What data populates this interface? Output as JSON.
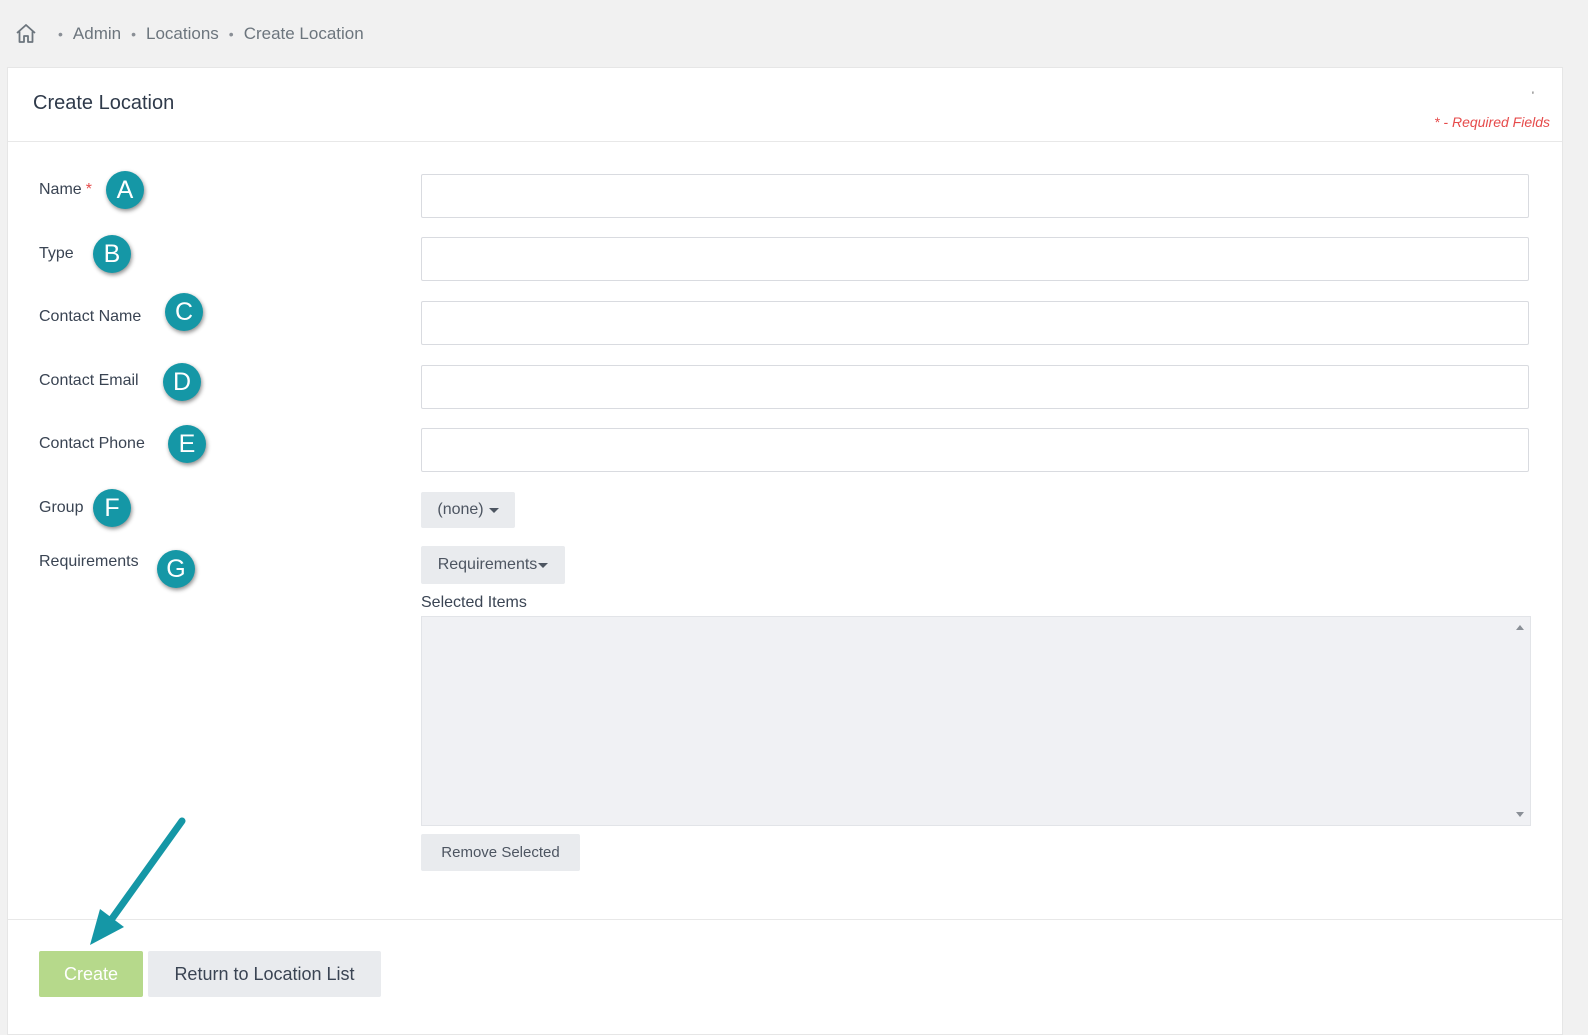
{
  "breadcrumb": {
    "items": [
      "Admin",
      "Locations",
      "Create Location"
    ]
  },
  "header": {
    "title": "Create Location",
    "required_note": "* - Required Fields",
    "tick": "'"
  },
  "form": {
    "fields": [
      {
        "label": "Name",
        "required": true,
        "badge": "A",
        "value": ""
      },
      {
        "label": "Type",
        "badge": "B",
        "value": ""
      },
      {
        "label": "Contact Name",
        "badge": "C",
        "value": ""
      },
      {
        "label": "Contact Email",
        "badge": "D",
        "value": ""
      },
      {
        "label": "Contact Phone",
        "badge": "E",
        "value": ""
      }
    ],
    "group": {
      "label": "Group",
      "badge": "F",
      "selected": "(none)"
    },
    "requirements": {
      "label": "Requirements",
      "badge": "G",
      "dropdown_label": "Requirements",
      "selected_items_label": "Selected Items",
      "remove_label": "Remove Selected"
    },
    "required_star": "*"
  },
  "footer": {
    "create_label": "Create",
    "return_label": "Return to Location List"
  },
  "colors": {
    "badge": "#1597a6",
    "create_button": "#b6d98b",
    "required": "#e64b4b",
    "arrow": "#1597a6"
  }
}
